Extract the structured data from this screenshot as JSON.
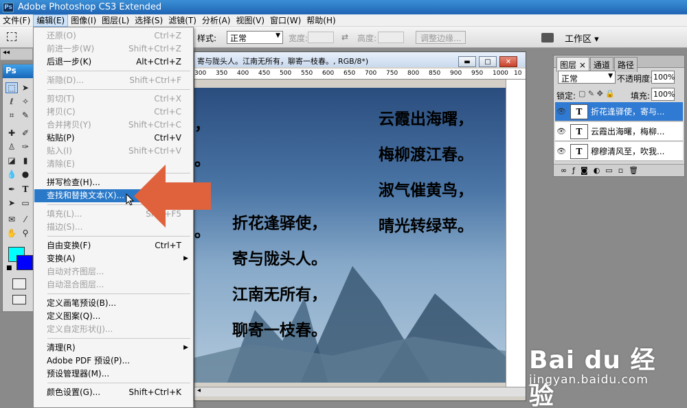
{
  "app": {
    "title": "Adobe Photoshop CS3 Extended",
    "logo": "Ps"
  },
  "menubar": [
    "文件(F)",
    "编辑(E)",
    "图像(I)",
    "图层(L)",
    "选择(S)",
    "滤镜(T)",
    "分析(A)",
    "视图(V)",
    "窗口(W)",
    "帮助(H)"
  ],
  "options": {
    "style_label": "样式:",
    "style_value": "正常",
    "width_label": "宽度:",
    "height_label": "高度:",
    "refine_button": "调整边缘...",
    "workspace": "工作区 ▾"
  },
  "edit_menu": {
    "items": [
      {
        "label": "还原(O)",
        "shortcut": "Ctrl+Z",
        "disabled": true
      },
      {
        "label": "前进一步(W)",
        "shortcut": "Shift+Ctrl+Z",
        "disabled": true
      },
      {
        "label": "后退一步(K)",
        "shortcut": "Alt+Ctrl+Z",
        "disabled": false
      },
      {
        "label": "渐隐(D)...",
        "shortcut": "Shift+Ctrl+F",
        "disabled": true
      },
      {
        "label": "剪切(T)",
        "shortcut": "Ctrl+X",
        "disabled": true
      },
      {
        "label": "拷贝(C)",
        "shortcut": "Ctrl+C",
        "disabled": true
      },
      {
        "label": "合并拷贝(Y)",
        "shortcut": "Shift+Ctrl+C",
        "disabled": true
      },
      {
        "label": "粘贴(P)",
        "shortcut": "Ctrl+V",
        "disabled": false
      },
      {
        "label": "贴入(I)",
        "shortcut": "Shift+Ctrl+V",
        "disabled": true
      },
      {
        "label": "清除(E)",
        "shortcut": "",
        "disabled": true
      },
      {
        "label": "拼写检查(H)...",
        "shortcut": "",
        "disabled": false
      },
      {
        "label": "查找和替换文本(X)...",
        "shortcut": "",
        "disabled": false,
        "highlighted": true
      },
      {
        "label": "填充(L)...",
        "shortcut": "Shift+F5",
        "disabled": true
      },
      {
        "label": "描边(S)...",
        "shortcut": "",
        "disabled": true
      },
      {
        "label": "自由变换(F)",
        "shortcut": "Ctrl+T",
        "disabled": false
      },
      {
        "label": "变换(A)",
        "shortcut": "",
        "disabled": false,
        "submenu": true
      },
      {
        "label": "自动对齐图层...",
        "shortcut": "",
        "disabled": true
      },
      {
        "label": "自动混合图层...",
        "shortcut": "",
        "disabled": true
      },
      {
        "label": "定义画笔预设(B)...",
        "shortcut": "",
        "disabled": false
      },
      {
        "label": "定义图案(Q)...",
        "shortcut": "",
        "disabled": false
      },
      {
        "label": "定义自定形状(J)...",
        "shortcut": "",
        "disabled": true
      },
      {
        "label": "清理(R)",
        "shortcut": "",
        "disabled": false,
        "submenu": true
      },
      {
        "label": "Adobe PDF 预设(P)...",
        "shortcut": "",
        "disabled": false
      },
      {
        "label": "预设管理器(M)...",
        "shortcut": "",
        "disabled": false
      },
      {
        "label": "颜色设置(G)...",
        "shortcut": "Shift+Ctrl+K",
        "disabled": false
      }
    ]
  },
  "document": {
    "title": "寄与陇头人。江南无所有，聊寄一枝春。, RGB/8*)",
    "ruler_ticks": [
      "300",
      "350",
      "400",
      "450",
      "500",
      "550",
      "600",
      "650",
      "700",
      "750",
      "800",
      "850",
      "900",
      "950",
      "1000",
      "10"
    ],
    "poem_right": [
      "云霞出海曙，",
      "梅柳渡江春。",
      "淑气催黄鸟，",
      "晴光转绿苹。"
    ],
    "poem_left": [
      "折花逢驿使，",
      "寄与陇头人。",
      "江南无所有，",
      "聊寄一枝春。"
    ],
    "poem_clipped": [
      "，",
      "。",
      "，",
      "。"
    ]
  },
  "layers": {
    "tabs": [
      "图层 ×",
      "通道",
      "路径"
    ],
    "blend_mode": "正常",
    "opacity_label": "不透明度:",
    "opacity": "100%",
    "lock_label": "锁定:",
    "fill_label": "填充:",
    "fill": "100%",
    "items": [
      {
        "name": "折花逢驿使，寄与...",
        "selected": true
      },
      {
        "name": "云霞出海曙，梅柳...",
        "selected": false
      },
      {
        "name": "穆穆清风至，吹我...",
        "selected": false
      }
    ],
    "thumb_letter": "T"
  },
  "toolbox": {
    "logo": "Ps"
  },
  "watermark": {
    "logo": "Bai du 经验",
    "sub": "jingyan.baidu.com"
  },
  "colors": {
    "accent": "#2a79c9",
    "arrow": "#e0623d",
    "foreground": "#00ffff",
    "background": "#0000ff"
  }
}
